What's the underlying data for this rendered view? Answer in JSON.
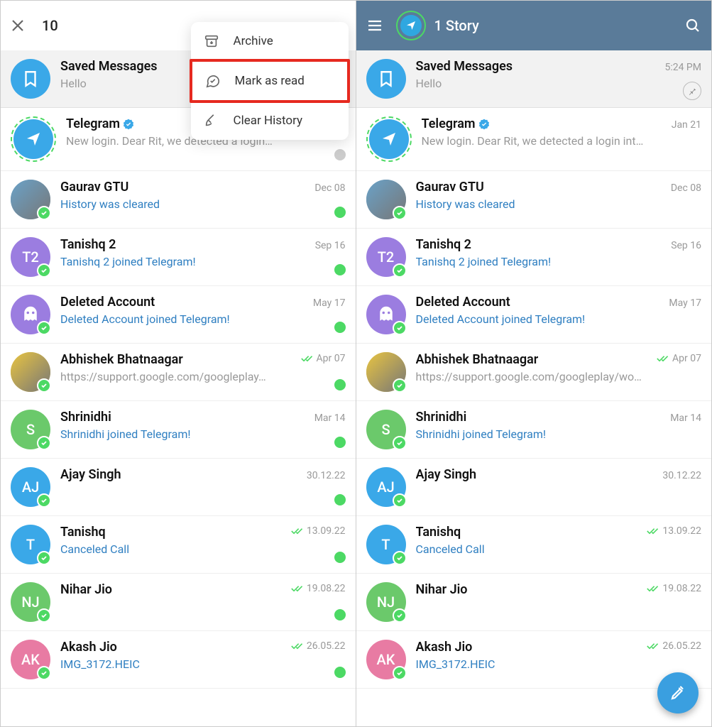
{
  "left": {
    "header": {
      "selected_count": "10"
    },
    "menu": {
      "archive": "Archive",
      "mark_read": "Mark as read",
      "clear_history": "Clear History"
    },
    "chats": [
      {
        "name": "Saved Messages",
        "sub": "Hello",
        "date": "",
        "verified": false,
        "checks": false,
        "dot": "none",
        "sub_link": false,
        "avatar": {
          "kind": "bookmark",
          "bg": "#3aa8e8"
        },
        "online": false,
        "pinned": true,
        "pin_icon": false
      },
      {
        "name": "Telegram",
        "sub": "New login. Dear Rit, we detected a login…",
        "date": "",
        "verified": true,
        "checks": false,
        "dot": "grey",
        "sub_link": false,
        "avatar": {
          "kind": "ringed-plane",
          "bg": "#3aa8e8"
        },
        "online": false
      },
      {
        "name": "Gaurav GTU",
        "sub": "History was cleared",
        "date": "Dec 08",
        "verified": false,
        "checks": false,
        "dot": "green",
        "sub_link": true,
        "avatar": {
          "kind": "photo",
          "bg": "#6aa2c8"
        },
        "online": true
      },
      {
        "name": "Tanishq 2",
        "sub": "Tanishq 2 joined Telegram!",
        "date": "Sep 16",
        "verified": false,
        "checks": false,
        "dot": "green",
        "sub_link": true,
        "avatar": {
          "kind": "initials",
          "txt": "T2",
          "bg": "#9b7de0"
        },
        "online": true
      },
      {
        "name": "Deleted Account",
        "sub": "Deleted Account joined Telegram!",
        "date": "May 17",
        "verified": false,
        "checks": false,
        "dot": "green",
        "sub_link": true,
        "avatar": {
          "kind": "ghost",
          "bg": "#9b7de0"
        },
        "online": true
      },
      {
        "name": "Abhishek Bhatnaagar",
        "sub": "https://support.google.com/googleplay…",
        "date": "Apr 07",
        "verified": false,
        "checks": true,
        "dot": "green",
        "sub_link": false,
        "avatar": {
          "kind": "photo",
          "bg": "#e8c441"
        },
        "online": true
      },
      {
        "name": "Shrinidhi",
        "sub": "Shrinidhi joined Telegram!",
        "date": "Mar 14",
        "verified": false,
        "checks": false,
        "dot": "green",
        "sub_link": true,
        "avatar": {
          "kind": "initials",
          "txt": "S",
          "bg": "#6bc96b"
        },
        "online": true
      },
      {
        "name": "Ajay Singh",
        "sub": "",
        "date": "30.12.22",
        "verified": false,
        "checks": false,
        "dot": "green",
        "sub_link": false,
        "avatar": {
          "kind": "initials",
          "txt": "AJ",
          "bg": "#3aa8e8"
        },
        "online": true
      },
      {
        "name": "Tanishq",
        "sub": "Canceled Call",
        "date": "13.09.22",
        "verified": false,
        "checks": true,
        "dot": "green",
        "sub_link": true,
        "avatar": {
          "kind": "initials",
          "txt": "T",
          "bg": "#3aa8e8"
        },
        "online": true
      },
      {
        "name": "Nihar Jio",
        "sub": "",
        "date": "19.08.22",
        "verified": false,
        "checks": true,
        "dot": "green",
        "sub_link": false,
        "avatar": {
          "kind": "initials",
          "txt": "NJ",
          "bg": "#6bc96b"
        },
        "online": true
      },
      {
        "name": "Akash Jio",
        "sub": "IMG_3172.HEIC",
        "date": "26.05.22",
        "verified": false,
        "checks": true,
        "dot": "green",
        "sub_link": true,
        "avatar": {
          "kind": "initials",
          "txt": "AK",
          "bg": "#e87ba3"
        },
        "online": true
      }
    ]
  },
  "right": {
    "header": {
      "title": "1 Story"
    },
    "chats": [
      {
        "name": "Saved Messages",
        "sub": "Hello",
        "date": "5:24 PM",
        "verified": false,
        "checks": false,
        "dot": "none",
        "sub_link": false,
        "avatar": {
          "kind": "bookmark",
          "bg": "#3aa8e8"
        },
        "online": false,
        "pinned": true,
        "pin_icon": true
      },
      {
        "name": "Telegram",
        "sub": "New login. Dear Rit, we detected a login int…",
        "date": "Jan 21",
        "verified": true,
        "checks": false,
        "dot": "none",
        "sub_link": false,
        "avatar": {
          "kind": "ringed-plane",
          "bg": "#3aa8e8"
        },
        "online": false
      },
      {
        "name": "Gaurav GTU",
        "sub": "History was cleared",
        "date": "Dec 08",
        "verified": false,
        "checks": false,
        "dot": "none",
        "sub_link": true,
        "avatar": {
          "kind": "photo",
          "bg": "#6aa2c8"
        },
        "online": true
      },
      {
        "name": "Tanishq 2",
        "sub": "Tanishq 2 joined Telegram!",
        "date": "Sep 16",
        "verified": false,
        "checks": false,
        "dot": "none",
        "sub_link": true,
        "avatar": {
          "kind": "initials",
          "txt": "T2",
          "bg": "#9b7de0"
        },
        "online": true
      },
      {
        "name": "Deleted Account",
        "sub": "Deleted Account joined Telegram!",
        "date": "May 17",
        "verified": false,
        "checks": false,
        "dot": "none",
        "sub_link": true,
        "avatar": {
          "kind": "ghost",
          "bg": "#9b7de0"
        },
        "online": true
      },
      {
        "name": "Abhishek Bhatnaagar",
        "sub": "https://support.google.com/googleplay/wo…",
        "date": "Apr 07",
        "verified": false,
        "checks": true,
        "dot": "none",
        "sub_link": false,
        "avatar": {
          "kind": "photo",
          "bg": "#e8c441"
        },
        "online": true
      },
      {
        "name": "Shrinidhi",
        "sub": "Shrinidhi joined Telegram!",
        "date": "Mar 14",
        "verified": false,
        "checks": false,
        "dot": "none",
        "sub_link": true,
        "avatar": {
          "kind": "initials",
          "txt": "S",
          "bg": "#6bc96b"
        },
        "online": true
      },
      {
        "name": "Ajay Singh",
        "sub": "",
        "date": "30.12.22",
        "verified": false,
        "checks": false,
        "dot": "none",
        "sub_link": false,
        "avatar": {
          "kind": "initials",
          "txt": "AJ",
          "bg": "#3aa8e8"
        },
        "online": true
      },
      {
        "name": "Tanishq",
        "sub": "Canceled Call",
        "date": "13.09.22",
        "verified": false,
        "checks": true,
        "dot": "none",
        "sub_link": true,
        "avatar": {
          "kind": "initials",
          "txt": "T",
          "bg": "#3aa8e8"
        },
        "online": true
      },
      {
        "name": "Nihar Jio",
        "sub": "",
        "date": "19.08.22",
        "verified": false,
        "checks": true,
        "dot": "none",
        "sub_link": false,
        "avatar": {
          "kind": "initials",
          "txt": "NJ",
          "bg": "#6bc96b"
        },
        "online": true
      },
      {
        "name": "Akash Jio",
        "sub": "IMG_3172.HEIC",
        "date": "26.05.22",
        "verified": false,
        "checks": true,
        "dot": "none",
        "sub_link": true,
        "avatar": {
          "kind": "initials",
          "txt": "AK",
          "bg": "#e87ba3"
        },
        "online": true
      }
    ]
  }
}
